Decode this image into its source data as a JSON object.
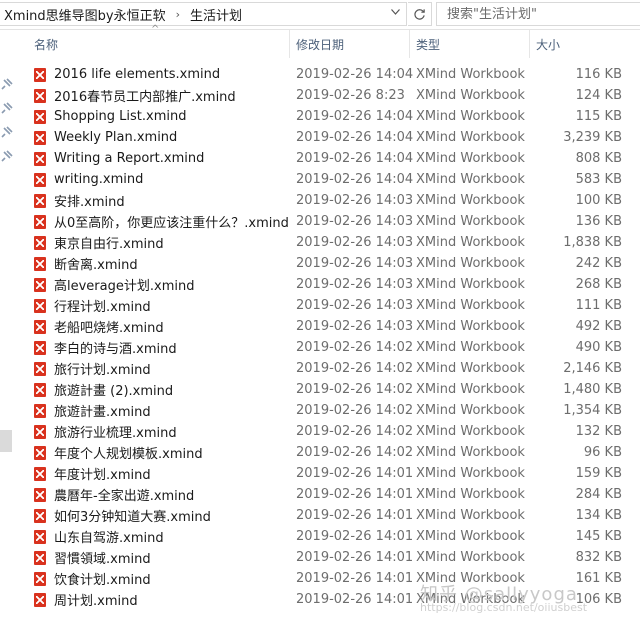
{
  "address": {
    "breadcrumbs": [
      "Xmind思维导图by永恒正软",
      "生活计划"
    ],
    "search_placeholder": "搜索\"生活计划\""
  },
  "icons": {
    "separator": "chevron-right-icon",
    "dropdown": "chevron-down-icon",
    "refresh": "refresh-icon",
    "pin": "pin-icon",
    "file": "xmind-file-icon"
  },
  "colors": {
    "file_icon": "#d9321e",
    "header_text": "#4c607a",
    "meta_text": "#6d6d6d"
  },
  "columns": {
    "name": "名称",
    "date": "修改日期",
    "type": "类型",
    "size": "大小"
  },
  "files": [
    {
      "name": "2016 life elements.xmind",
      "date": "2019-02-26 14:04",
      "type": "XMind Workbook",
      "size": "116 KB"
    },
    {
      "name": "2016春节员工内部推广.xmind",
      "date": "2019-02-26 8:23",
      "type": "XMind Workbook",
      "size": "124 KB"
    },
    {
      "name": "Shopping List.xmind",
      "date": "2019-02-26 14:04",
      "type": "XMind Workbook",
      "size": "115 KB"
    },
    {
      "name": "Weekly Plan.xmind",
      "date": "2019-02-26 14:04",
      "type": "XMind Workbook",
      "size": "3,239 KB"
    },
    {
      "name": "Writing a Report.xmind",
      "date": "2019-02-26 14:04",
      "type": "XMind Workbook",
      "size": "808 KB"
    },
    {
      "name": "writing.xmind",
      "date": "2019-02-26 14:04",
      "type": "XMind Workbook",
      "size": "583 KB"
    },
    {
      "name": "安排.xmind",
      "date": "2019-02-26 14:03",
      "type": "XMind Workbook",
      "size": "100 KB"
    },
    {
      "name": "从0至高阶，你更应该注重什么？.xmind",
      "date": "2019-02-26 14:03",
      "type": "XMind Workbook",
      "size": "136 KB"
    },
    {
      "name": "東京自由行.xmind",
      "date": "2019-02-26 14:03",
      "type": "XMind Workbook",
      "size": "1,838 KB"
    },
    {
      "name": "断舍离.xmind",
      "date": "2019-02-26 14:03",
      "type": "XMind Workbook",
      "size": "242 KB"
    },
    {
      "name": "高leverage计划.xmind",
      "date": "2019-02-26 14:03",
      "type": "XMind Workbook",
      "size": "268 KB"
    },
    {
      "name": "行程计划.xmind",
      "date": "2019-02-26 14:03",
      "type": "XMind Workbook",
      "size": "111 KB"
    },
    {
      "name": "老船吧烧烤.xmind",
      "date": "2019-02-26 14:03",
      "type": "XMind Workbook",
      "size": "492 KB"
    },
    {
      "name": "李白的诗与酒.xmind",
      "date": "2019-02-26 14:02",
      "type": "XMind Workbook",
      "size": "490 KB"
    },
    {
      "name": "旅行计划.xmind",
      "date": "2019-02-26 14:02",
      "type": "XMind Workbook",
      "size": "2,146 KB"
    },
    {
      "name": "旅遊計畫 (2).xmind",
      "date": "2019-02-26 14:02",
      "type": "XMind Workbook",
      "size": "1,480 KB"
    },
    {
      "name": "旅遊計畫.xmind",
      "date": "2019-02-26 14:02",
      "type": "XMind Workbook",
      "size": "1,354 KB"
    },
    {
      "name": "旅游行业梳理.xmind",
      "date": "2019-02-26 14:02",
      "type": "XMind Workbook",
      "size": "132 KB"
    },
    {
      "name": "年度个人规划模板.xmind",
      "date": "2019-02-26 14:02",
      "type": "XMind Workbook",
      "size": "96 KB"
    },
    {
      "name": "年度计划.xmind",
      "date": "2019-02-26 14:01",
      "type": "XMind Workbook",
      "size": "159 KB"
    },
    {
      "name": "農曆年-全家出遊.xmind",
      "date": "2019-02-26 14:01",
      "type": "XMind Workbook",
      "size": "284 KB"
    },
    {
      "name": "如何3分钟知道大赛.xmind",
      "date": "2019-02-26 14:01",
      "type": "XMind Workbook",
      "size": "134 KB"
    },
    {
      "name": "山东自驾游.xmind",
      "date": "2019-02-26 14:01",
      "type": "XMind Workbook",
      "size": "145 KB"
    },
    {
      "name": "習慣領域.xmind",
      "date": "2019-02-26 14:01",
      "type": "XMind Workbook",
      "size": "832 KB"
    },
    {
      "name": "饮食计划.xmind",
      "date": "2019-02-26 14:01",
      "type": "XMind Workbook",
      "size": "161 KB"
    },
    {
      "name": "周计划.xmind",
      "date": "2019-02-26 14:01",
      "type": "XMind Workbook",
      "size": "106 KB"
    }
  ],
  "watermark": {
    "main": "知乎 @sallyyoga",
    "sub": "https://blog.csdn.net/oiiusbest"
  }
}
